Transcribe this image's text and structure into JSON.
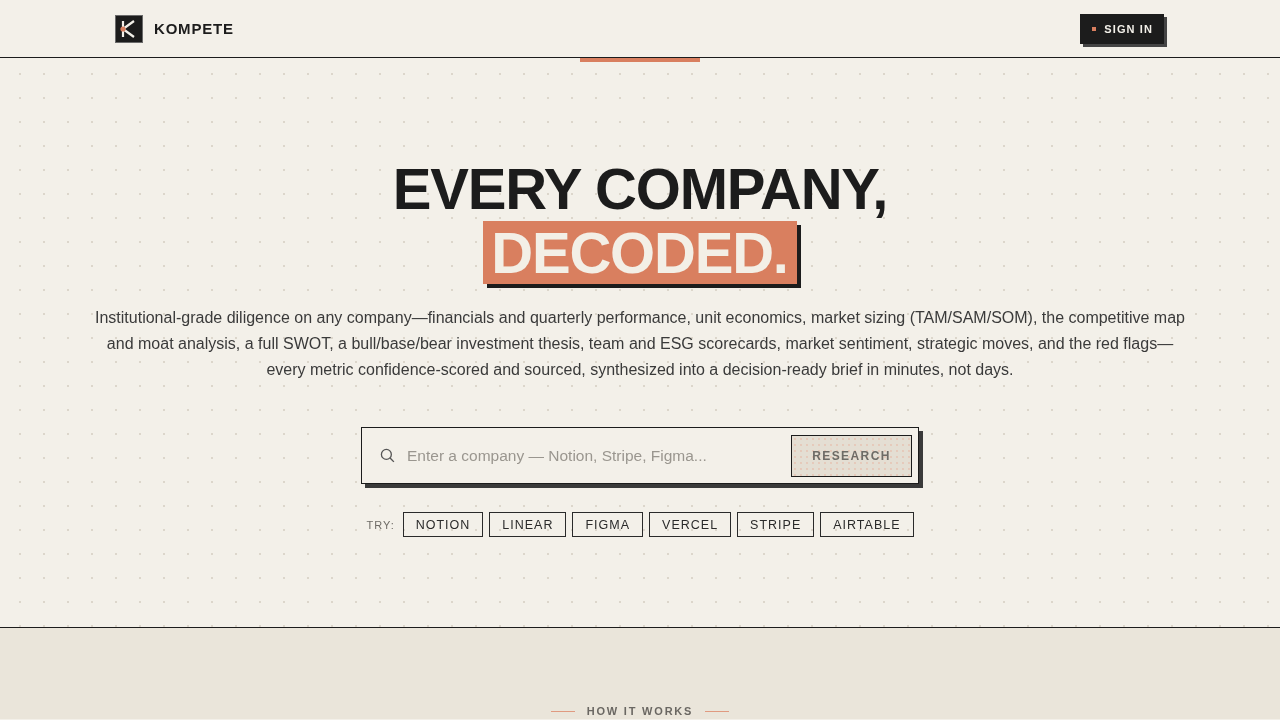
{
  "header": {
    "brand": "KOMPETE",
    "sign_in": "SIGN IN"
  },
  "hero": {
    "title": "EVERY COMPANY,",
    "highlight": "DECODED.",
    "description": "Institutional-grade diligence on any company—financials and quarterly performance, unit economics, market sizing (TAM/SAM/SOM), the competitive map and moat analysis, a full SWOT, a bull/base/bear investment thesis, team and ESG scorecards, market sentiment, strategic moves, and the red flags—every metric confidence-scored and sourced, synthesized into a decision-ready brief in minutes, not days.",
    "search": {
      "placeholder": "Enter a company — Notion, Stripe, Figma...",
      "button": {
        "label": "RESEARCH",
        "disabled": true
      }
    },
    "try": {
      "label": "TRY:",
      "chips": [
        "NOTION",
        "LINEAR",
        "FIGMA",
        "VERCEL",
        "STRIPE",
        "AIRTABLE"
      ]
    }
  },
  "how_it_works": {
    "label": "HOW IT WORKS"
  }
}
